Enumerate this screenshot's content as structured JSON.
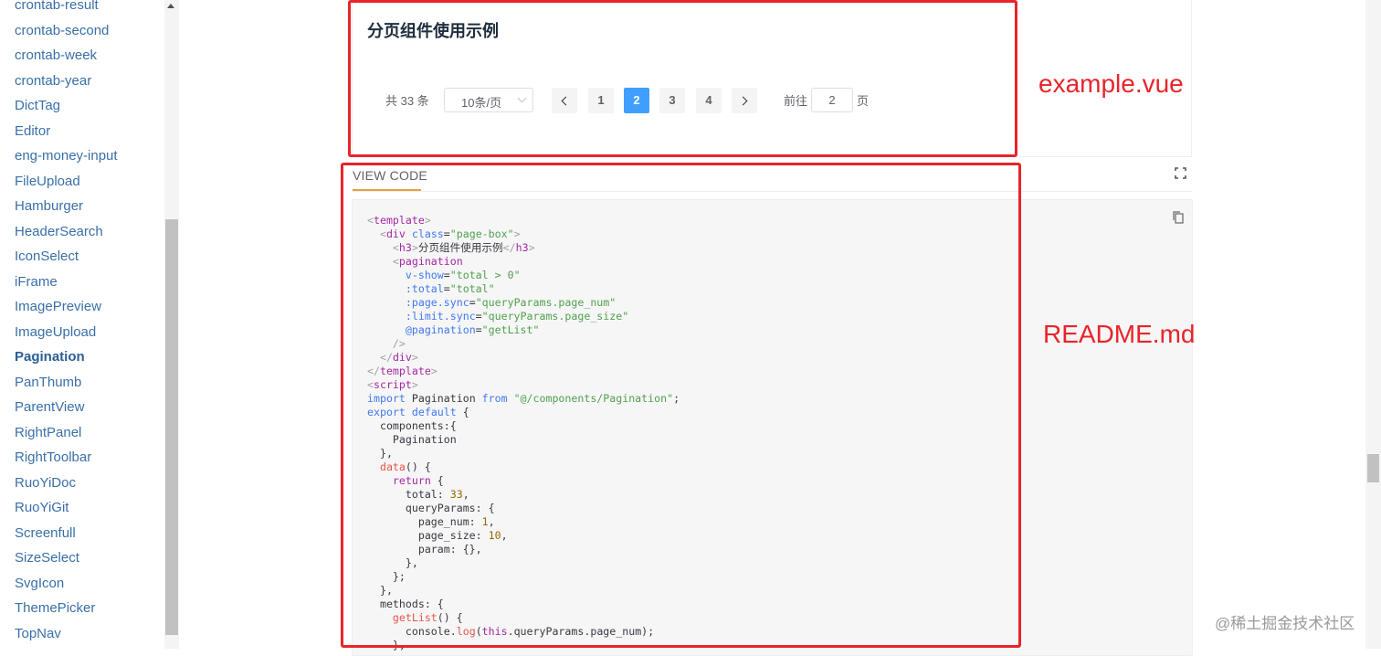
{
  "sidebar": {
    "items": [
      {
        "label": "crontab-result",
        "active": false
      },
      {
        "label": "crontab-second",
        "active": false
      },
      {
        "label": "crontab-week",
        "active": false
      },
      {
        "label": "crontab-year",
        "active": false
      },
      {
        "label": "DictTag",
        "active": false
      },
      {
        "label": "Editor",
        "active": false
      },
      {
        "label": "eng-money-input",
        "active": false
      },
      {
        "label": "FileUpload",
        "active": false
      },
      {
        "label": "Hamburger",
        "active": false
      },
      {
        "label": "HeaderSearch",
        "active": false
      },
      {
        "label": "IconSelect",
        "active": false
      },
      {
        "label": "iFrame",
        "active": false
      },
      {
        "label": "ImagePreview",
        "active": false
      },
      {
        "label": "ImageUpload",
        "active": false
      },
      {
        "label": "Pagination",
        "active": true
      },
      {
        "label": "PanThumb",
        "active": false
      },
      {
        "label": "ParentView",
        "active": false
      },
      {
        "label": "RightPanel",
        "active": false
      },
      {
        "label": "RightToolbar",
        "active": false
      },
      {
        "label": "RuoYiDoc",
        "active": false
      },
      {
        "label": "RuoYiGit",
        "active": false
      },
      {
        "label": "Screenfull",
        "active": false
      },
      {
        "label": "SizeSelect",
        "active": false
      },
      {
        "label": "SvgIcon",
        "active": false
      },
      {
        "label": "ThemePicker",
        "active": false
      },
      {
        "label": "TopNav",
        "active": false
      }
    ]
  },
  "demo": {
    "title": "分页组件使用示例",
    "pagination": {
      "total_text": "共 33 条",
      "page_size_label": "10条/页",
      "pages": [
        "1",
        "2",
        "3",
        "4"
      ],
      "current_page": "2",
      "jump_prefix": "前往",
      "jump_value": "2",
      "jump_suffix": "页"
    }
  },
  "code_section": {
    "tab_label": "VIEW CODE",
    "icons": [
      "fullscreen-icon",
      "copy-icon",
      "chevron-left-icon",
      "chevron-right-icon"
    ]
  },
  "annotations": {
    "top_label": "example.vue",
    "bottom_label": "README.md"
  },
  "watermark": "@稀土掘金技术社区",
  "colors": {
    "accent_blue": "#409eff",
    "annotation_red": "#e8242a",
    "tab_underline": "#e6a23c",
    "sidebar_link": "#3a6fa8"
  }
}
